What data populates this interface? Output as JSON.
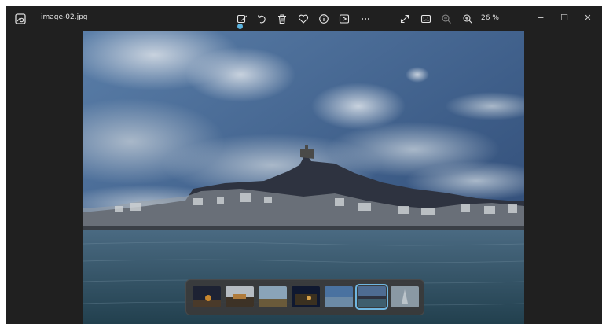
{
  "window": {
    "filename": "image-02.jpg",
    "zoom": "26 %",
    "controls": {
      "minimize": "−",
      "maximize": "☐",
      "close": "✕"
    }
  },
  "toolbar": {
    "icons": [
      "edit-image-icon",
      "rotate-icon",
      "delete-icon",
      "favorite-icon",
      "info-icon",
      "slideshow-icon",
      "more-icon",
      "fullscreen-icon",
      "actual-size-icon",
      "zoom-out-icon",
      "zoom-in-icon"
    ]
  },
  "filmstrip": {
    "count": 7,
    "selected_index": 5
  },
  "colors": {
    "window_bg": "#202020",
    "accent": "#6fb6e0"
  }
}
